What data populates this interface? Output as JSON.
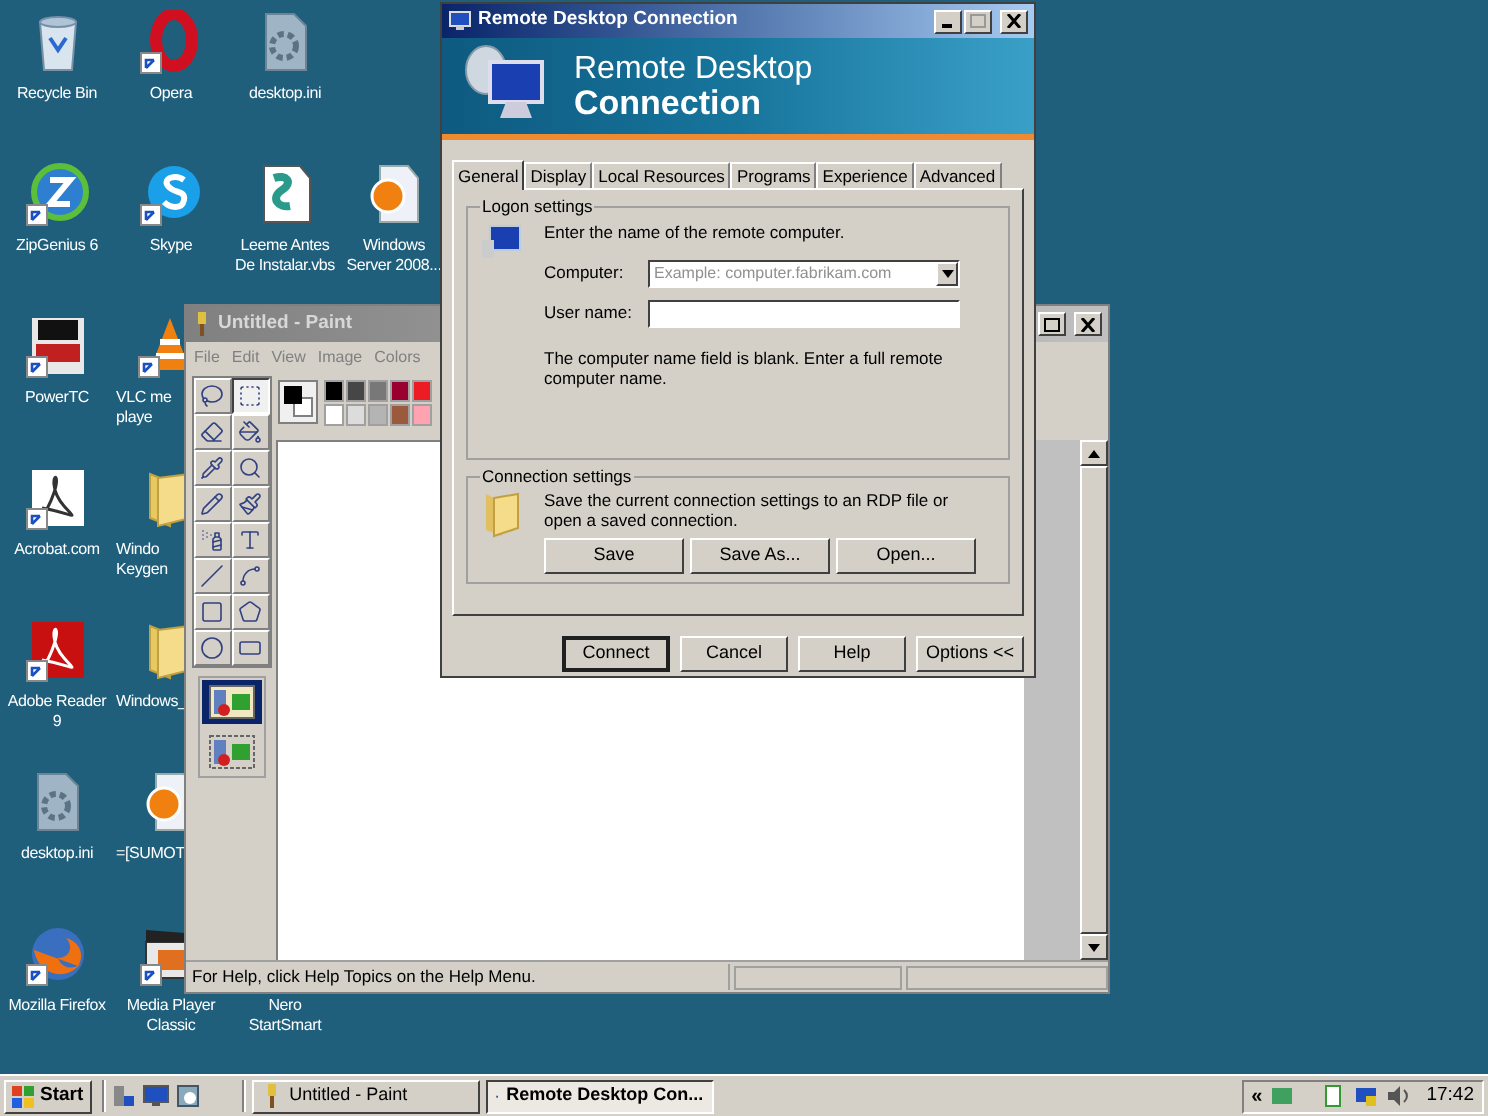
{
  "desktop": {
    "columns": [
      [
        {
          "label": [
            "Recycle Bin"
          ],
          "kind": "recycle",
          "shortcut": false
        },
        {
          "label": [
            "ZipGenius 6"
          ],
          "kind": "zip",
          "shortcut": true
        },
        {
          "label": [
            "PowerTC"
          ],
          "kind": "powertc",
          "shortcut": true
        },
        {
          "label": [
            "Acrobat.com"
          ],
          "kind": "acrobat",
          "shortcut": true
        },
        {
          "label": [
            "Adobe Reader",
            "9"
          ],
          "kind": "adobe",
          "shortcut": true
        },
        {
          "label": [
            "desktop.ini"
          ],
          "kind": "ini",
          "shortcut": false
        },
        {
          "label": [
            "Mozilla Firefox"
          ],
          "kind": "firefox",
          "shortcut": true
        }
      ],
      [
        {
          "label": [
            "Opera"
          ],
          "kind": "opera",
          "shortcut": true
        },
        {
          "label": [
            "Skype"
          ],
          "kind": "skype",
          "shortcut": true
        },
        {
          "label": [
            "VLC me",
            "playe"
          ],
          "kind": "vlc",
          "shortcut": true
        },
        {
          "label": [
            "Windo",
            "Keygen"
          ],
          "kind": "folder",
          "shortcut": false
        },
        {
          "label": [
            "Windows_"
          ],
          "kind": "folder",
          "shortcut": false
        },
        {
          "label": [
            "=[SUMOT"
          ],
          "kind": "media",
          "shortcut": false
        },
        {
          "label": [
            "Media Player",
            "Classic"
          ],
          "kind": "mpc",
          "shortcut": true
        }
      ],
      [
        {
          "label": [
            "desktop.ini"
          ],
          "kind": "ini",
          "shortcut": false
        },
        {
          "label": [
            "Leeme Antes",
            "De Instalar.vbs"
          ],
          "kind": "script",
          "shortcut": false
        },
        null,
        null,
        null,
        null,
        {
          "label": [
            "Nero",
            "StartSmart"
          ],
          "kind": "none"
        }
      ],
      [
        null,
        {
          "label": [
            "Windows",
            "Server 2008..."
          ],
          "kind": "media",
          "shortcut": false
        },
        null,
        null,
        null,
        null,
        null
      ]
    ]
  },
  "paint": {
    "title": "Untitled - Paint",
    "menu": [
      "File",
      "Edit",
      "View",
      "Image",
      "Colors"
    ],
    "tools": [
      {
        "kind": "free-select",
        "selected": false
      },
      {
        "kind": "select",
        "selected": true
      },
      {
        "kind": "eraser",
        "selected": false
      },
      {
        "kind": "fill",
        "selected": false
      },
      {
        "kind": "picker",
        "selected": false
      },
      {
        "kind": "magnifier",
        "selected": false
      },
      {
        "kind": "pencil",
        "selected": false
      },
      {
        "kind": "brush",
        "selected": false
      },
      {
        "kind": "airbrush",
        "selected": false
      },
      {
        "kind": "text",
        "selected": false
      },
      {
        "kind": "line",
        "selected": false
      },
      {
        "kind": "curve",
        "selected": false
      },
      {
        "kind": "rectangle",
        "selected": false
      },
      {
        "kind": "polygon",
        "selected": false
      },
      {
        "kind": "ellipse",
        "selected": false
      },
      {
        "kind": "rounded-rectangle",
        "selected": false
      }
    ],
    "transparency": [
      {
        "selected": true
      },
      {
        "selected": false
      }
    ],
    "palette": [
      {
        "color": "#000000"
      },
      {
        "color": "#ffffff"
      },
      {
        "color": "#464646"
      },
      {
        "color": "#dcdcdc"
      },
      {
        "color": "#787878"
      },
      {
        "color": "#b4b4b4"
      },
      {
        "color": "#990030"
      },
      {
        "color": "#9c5a3c"
      },
      {
        "color": "#ed1c24"
      },
      {
        "color": "#ffa3b1"
      }
    ],
    "status": "For Help, click Help Topics on the Help Menu."
  },
  "rdp": {
    "title": "Remote Desktop Connection",
    "banner": [
      "Remote Desktop",
      "Connection"
    ],
    "tabs": [
      {
        "label": "General",
        "selected": true
      },
      {
        "label": "Display",
        "selected": false
      },
      {
        "label": "Local Resources",
        "selected": false
      },
      {
        "label": "Programs",
        "selected": false
      },
      {
        "label": "Experience",
        "selected": false
      },
      {
        "label": "Advanced",
        "selected": false
      }
    ],
    "logon": {
      "legend": "Logon settings",
      "instruction": "Enter the name of the remote computer.",
      "computer_label": "Computer:",
      "computer_placeholder": "Example: computer.fabrikam.com",
      "user_label": "User name:",
      "note": "The computer name field is blank. Enter a full remote computer name."
    },
    "connection": {
      "legend": "Connection settings",
      "text": "Save the current connection settings to an RDP file or open a saved connection.",
      "buttons": [
        "Save",
        "Save As...",
        "Open..."
      ]
    },
    "buttons": [
      {
        "label": "Connect",
        "default": true
      },
      {
        "label": "Cancel",
        "default": false
      },
      {
        "label": "Help",
        "default": false
      },
      {
        "label": "Options <<",
        "default": false
      }
    ]
  },
  "taskbar": {
    "start": "Start",
    "tasks": [
      {
        "label": "Untitled - Paint",
        "selected": false,
        "kind": "paint"
      },
      {
        "label": "Remote Desktop Con...",
        "selected": true,
        "kind": "rdp"
      }
    ],
    "tray_toggle": "«",
    "clock": "17:42"
  }
}
